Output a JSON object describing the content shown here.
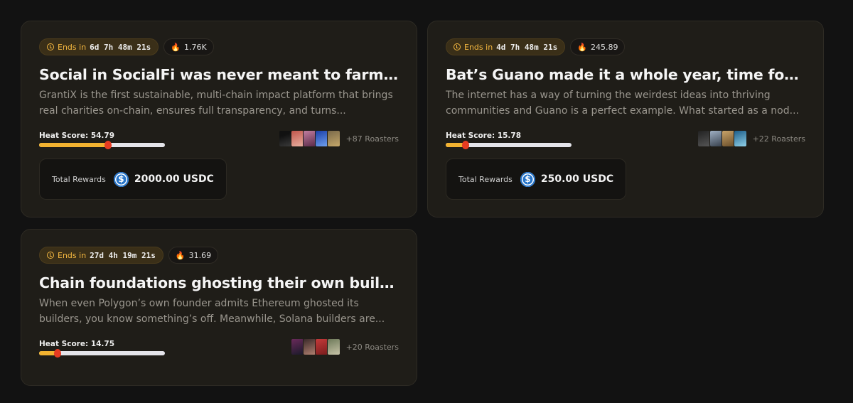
{
  "cards": [
    {
      "ends_label": "Ends in",
      "countdown": "6d 7h 48m 21s",
      "heat_value": "1.76K",
      "title": "Social in SocialFi was never meant to farm likes....",
      "description": "GrantiX is the first sustainable, multi-chain impact platform that brings real charities on-chain, ensures full transparency, and turns...",
      "heat_score_label": "Heat Score: 54.79",
      "heat_score": 54.79,
      "roasters": "+87 Roasters",
      "rewards_label": "Total Rewards",
      "rewards_amount": "2000.00 USDC"
    },
    {
      "ends_label": "Ends in",
      "countdown": "4d 7h 48m 21s",
      "heat_value": "245.89",
      "title": "Bat’s Guano made it a whole year, time for the...",
      "description": "The internet has a way of turning the weirdest ideas into thriving communities and Guano is a perfect example. What started as a nod...",
      "heat_score_label": "Heat Score: 15.78",
      "heat_score": 15.78,
      "roasters": "+22 Roasters",
      "rewards_label": "Total Rewards",
      "rewards_amount": "250.00 USDC"
    },
    {
      "ends_label": "Ends in",
      "countdown": "27d 4h 19m 21s",
      "heat_value": "31.69",
      "title": "Chain foundations ghosting their own builders i...",
      "description": "When even Polygon’s own founder admits Ethereum ghosted its builders, you know something’s off. Meanwhile, Solana builders are...",
      "heat_score_label": "Heat Score: 14.75",
      "heat_score": 14.75,
      "roasters": "+20 Roasters"
    }
  ],
  "colors": {
    "accent": "#f4b740",
    "usdc": "#2775ca",
    "heat_knob": "#e63b22"
  }
}
